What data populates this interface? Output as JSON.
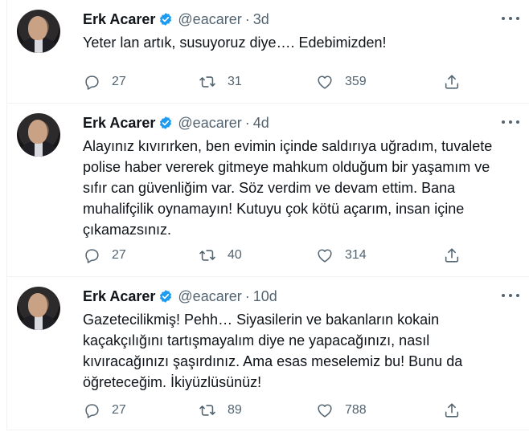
{
  "tweets": [
    {
      "name": "Erk Acarer",
      "handle": "@eacarer",
      "separator": "·",
      "time": "3d",
      "text": "Yeter lan artık, susuyoruz diye…. Edebimizden!",
      "replies": "27",
      "retweets": "31",
      "likes": "359"
    },
    {
      "name": "Erk Acarer",
      "handle": "@eacarer",
      "separator": "·",
      "time": "4d",
      "text": "Alayınız kıvırırken, ben evimin içinde saldırıya uğradım, tuvalete polise haber vererek gitmeye mahkum olduğum bir yaşamım ve sıfır can güvenliğim var. Söz verdim ve devam ettim. Bana muhalifçilik oynamayın! Kutuyu çok kötü açarım, insan içine çıkamazsınız.",
      "replies": "27",
      "retweets": "40",
      "likes": "314"
    },
    {
      "name": "Erk Acarer",
      "handle": "@eacarer",
      "separator": "·",
      "time": "10d",
      "text": "Gazetecilikmiş! Pehh… Siyasilerin ve bakanların kokain kaçakçılığını tartışmayalım diye ne yapacağınızı, nasıl kıvıracağınızı şaşırdınız. Ama esas meselemiz bu! Bunu da öğreteceğim. İkiyüzlüsünüz!",
      "replies": "27",
      "retweets": "89",
      "likes": "788"
    }
  ],
  "icons": {
    "reply": "reply-icon",
    "retweet": "retweet-icon",
    "like": "heart-icon",
    "share": "share-icon",
    "verified": "verified-badge-icon",
    "more": "more-options-icon"
  },
  "colors": {
    "verified_blue": "#1d9bf0",
    "muted_text": "#536471",
    "main_text": "#0f1419",
    "border": "#eff3f4"
  }
}
